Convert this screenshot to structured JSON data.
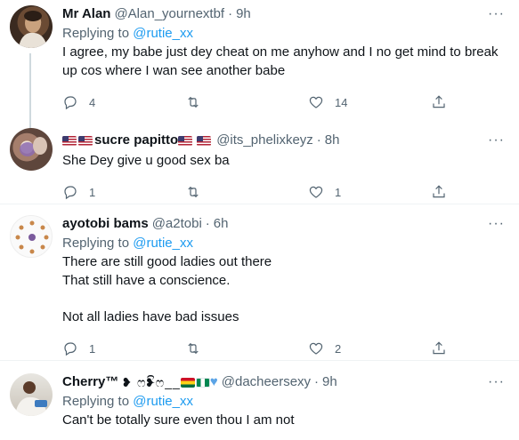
{
  "tweets": [
    {
      "name": "Mr Alan",
      "handle": "@Alan_yournextbf",
      "dot": "·",
      "time": "9h",
      "replying_prefix": "Replying to",
      "replying_to": "@rutie_xx",
      "text_lines": [
        "I agree, my babe just dey cheat on me anyhow and I no get mind to break up cos where I wan see another babe"
      ],
      "replies": "4",
      "retweets": "",
      "likes": "14"
    },
    {
      "name": "sucre papitto",
      "handle": "@its_phelixkeyz",
      "dot": "·",
      "time": "8h",
      "text_lines": [
        "She Dey give u good sex ba"
      ],
      "replies": "1",
      "retweets": "",
      "likes": "1"
    },
    {
      "name": "ayotobi bams",
      "handle": "@a2tobi",
      "dot": "·",
      "time": "6h",
      "replying_prefix": "Replying to",
      "replying_to": "@rutie_xx",
      "text_lines": [
        "There are still good ladies out there",
        "That still have a conscience.",
        "",
        "Not all ladies have bad issues"
      ],
      "replies": "1",
      "retweets": "",
      "likes": "2"
    },
    {
      "name": "Cherry™",
      "name_glyphs": "❥ ෆ❥ිෆ__",
      "handle": "@dacheersexy",
      "dot": "·",
      "time": "9h",
      "replying_prefix": "Replying to",
      "replying_to": "@rutie_xx",
      "text_lines": [
        "Can't be totally sure even thou I am not"
      ]
    }
  ],
  "icons": {
    "reply": "reply-icon",
    "retweet": "retweet-icon",
    "like": "heart-icon",
    "share": "share-icon",
    "more": "more-icon"
  },
  "more_glyph": "···",
  "colors": {
    "link": "#1d9bf0",
    "secondary": "#536471",
    "divider": "#eff3f4"
  }
}
